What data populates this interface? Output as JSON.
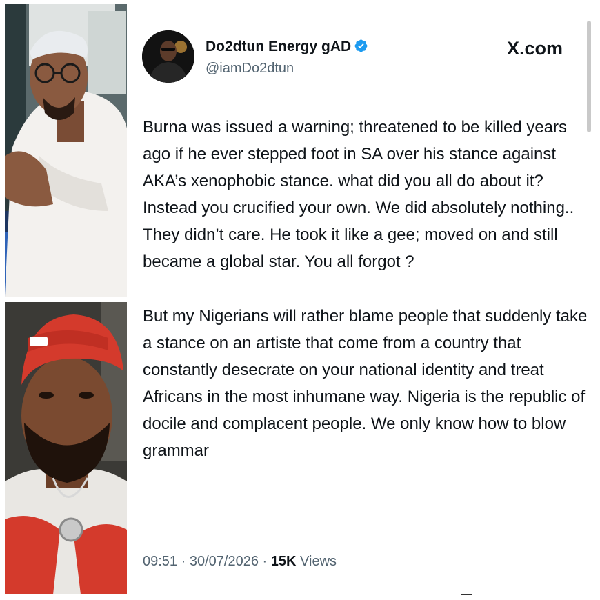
{
  "post": {
    "author_name": "Do2dtun Energy gAD",
    "handle": "@iamDo2dtun",
    "verified": true,
    "platform": "X.com",
    "paragraphs": [
      "Burna was issued a warning; threatened to be killed years ago if he ever stepped foot in SA over his stance against AKA’s xenophobic stance. what did you all do about it? Instead you crucified your own. We did absolutely nothing.. They didn’t care. He took it like a gee; moved on and still became a global star. You all forgot ?",
      "But my Nigerians will rather blame people that suddenly take a stance on an artiste  that come from a country that constantly desecrate on your national identity and treat Africans in the most inhumane way. Nigeria is the republic of docile and complacent people. We only know how to blow grammar"
    ],
    "time": "09:51",
    "date": "30/07/2026",
    "separator": "·",
    "views_count": "15K",
    "views_label": "Views"
  },
  "colors": {
    "text_primary": "#0f1419",
    "text_secondary": "#536471",
    "verified_blue": "#1d9bf0",
    "cap_red": "#d43a2c"
  },
  "icons": {
    "verified": "verified-badge-icon"
  }
}
